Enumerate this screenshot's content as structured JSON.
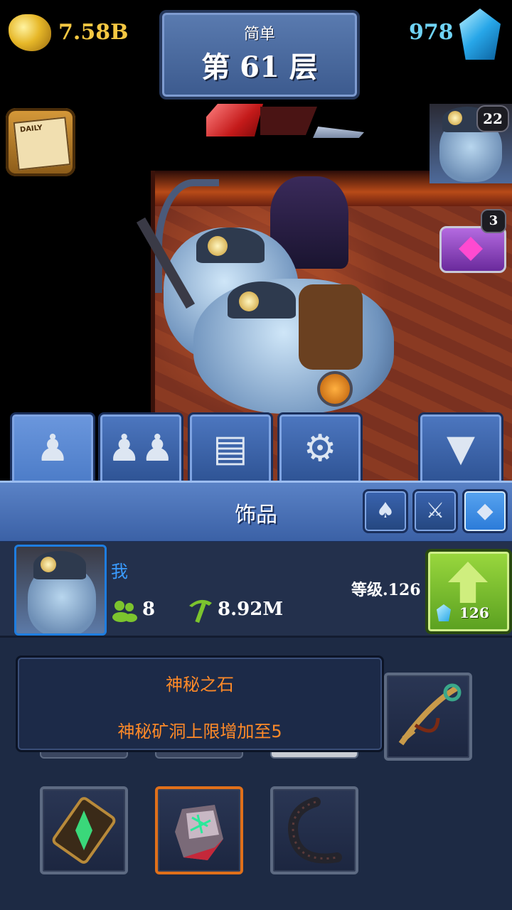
{
  "hud": {
    "gold_amount": "7.58B",
    "gem_amount": "978",
    "difficulty": "简单",
    "floor_label": "第 61 层",
    "daily_label": "DAILY",
    "portrait_badge": "22",
    "chest_badge": "3"
  },
  "tabs": [
    {
      "name": "character",
      "icon": "miner-profile-icon",
      "active": true
    },
    {
      "name": "team",
      "icon": "group-icon",
      "active": false
    },
    {
      "name": "chest",
      "icon": "chest-icon",
      "active": false
    },
    {
      "name": "settings",
      "icon": "gear-icon",
      "active": false
    },
    {
      "name": "collapse",
      "icon": "chevron-down-icon",
      "active": false
    }
  ],
  "panel": {
    "title": "饰品",
    "category_buttons": [
      {
        "name": "strength-category",
        "icon": "muscle-icon",
        "active": false
      },
      {
        "name": "weapons-category",
        "icon": "crossed-swords-icon",
        "active": false
      },
      {
        "name": "accessories-category",
        "icon": "rocks-icon",
        "active": true
      }
    ]
  },
  "player": {
    "name": "我",
    "workers": "8",
    "mining_power": "8.92M",
    "level_label": "等级.126",
    "upgrade_cost": "126"
  },
  "tooltip": {
    "title": "神秘之石",
    "description": "神秘矿洞上限增加至5"
  },
  "inventory": {
    "items": [
      {
        "name": "key-item",
        "icon": "ornate-key-icon"
      },
      {
        "name": "scroll-item",
        "icon": "green-crystal-scroll-icon"
      },
      {
        "name": "mysterious-stone-item",
        "icon": "rune-stone-icon",
        "selected": true
      },
      {
        "name": "tentacle-item",
        "icon": "dark-tentacle-icon"
      }
    ]
  },
  "colors": {
    "gold": "#f5c842",
    "gem": "#6fd3f5",
    "accent_blue": "#3a9cff",
    "tooltip_text": "#ff8a28",
    "upgrade_green": "#7cc42e",
    "selected_border": "#e0701a"
  }
}
